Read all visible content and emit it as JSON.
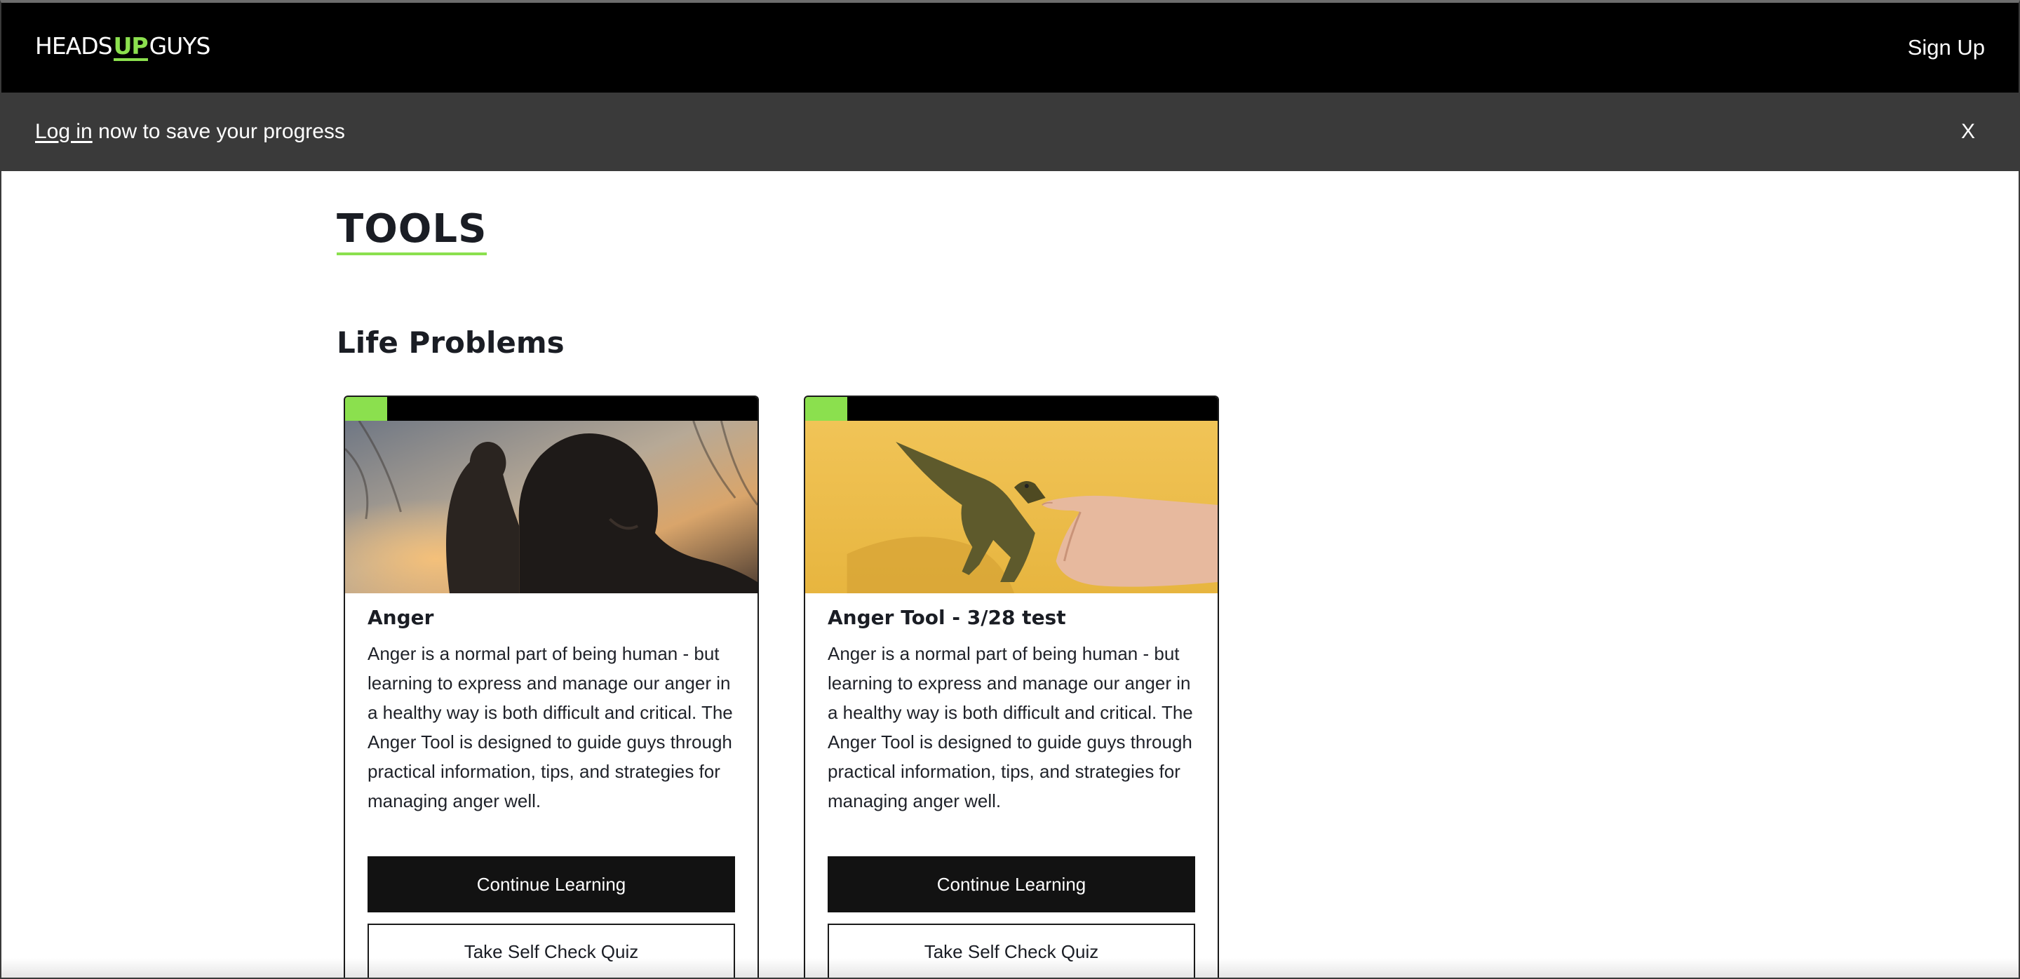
{
  "header": {
    "logo": {
      "heads": "HEADS",
      "up": "UP",
      "guys": "GUYS"
    },
    "signup_label": "Sign Up"
  },
  "banner": {
    "login_link": "Log in",
    "message": " now to save your progress",
    "close_label": "X"
  },
  "main": {
    "page_title": "TOOLS",
    "section_title": "Life Problems",
    "cards": [
      {
        "title": "Anger",
        "image_icon": "man-praying-silhouette-photo",
        "description": "Anger is a normal part of being human - but learning to express and manage our anger in a healthy way is both difficult and critical. The Anger Tool is designed to guide guys through practical information, tips, and strategies for managing anger well.",
        "primary_button": "Continue Learning",
        "secondary_button": "Take Self Check Quiz"
      },
      {
        "title": "Anger Tool - 3/28 test",
        "image_icon": "dinosaur-biting-finger-photo",
        "description": "Anger is a normal part of being human - but learning to express and manage our anger in a healthy way is both difficult and critical. The Anger Tool is designed to guide guys through practical information, tips, and strategies for managing anger well.",
        "primary_button": "Continue Learning",
        "secondary_button": "Take Self Check Quiz"
      }
    ]
  },
  "colors": {
    "accent_green": "#8be04e",
    "topbar_bg": "#000000",
    "banner_bg": "#3a3a3a",
    "button_dark": "#121212"
  }
}
